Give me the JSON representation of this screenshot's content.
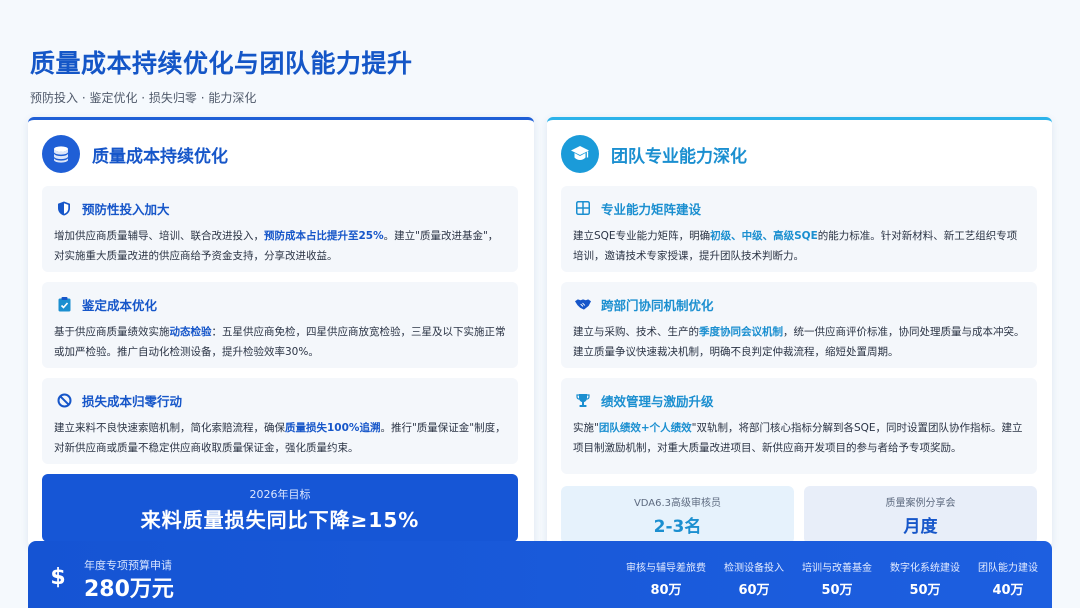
{
  "header": {
    "title": "质量成本持续优化与团队能力提升",
    "subtitle": "预防投入 · 鉴定优化 · 损失归零 · 能力深化"
  },
  "left_card": {
    "icon": "coins-icon",
    "title": "质量成本持续优化",
    "sections": [
      {
        "icon": "shield-icon",
        "title": "预防性投入加大",
        "body_a": "增加供应商质量辅导、培训、联合改进投入，",
        "body_hl": "预防成本占比提升至25%",
        "body_b": "。建立\"质量改进基金\"，对实施重大质量改进的供应商给予资金支持，分享改进收益。"
      },
      {
        "icon": "clipboard-check-icon",
        "title": "鉴定成本优化",
        "body_a": "基于供应商质量绩效实施",
        "body_hl": "动态检验",
        "body_b": "：五星供应商免检，四星供应商放宽检验，三星及以下实施正常或加严检验。推广自动化检测设备，提升检验效率30%。"
      },
      {
        "icon": "ban-icon",
        "title": "损失成本归零行动",
        "body_a": "建立来料不良快速索赔机制，简化索赔流程，确保",
        "body_hl": "质量损失100%追溯",
        "body_b": "。推行\"质量保证金\"制度，对新供应商或质量不稳定供应商收取质量保证金，强化质量约束。"
      }
    ],
    "goal": {
      "label": "2026年目标",
      "value": "来料质量损失同比下降≥15%"
    }
  },
  "right_card": {
    "icon": "graduation-cap-icon",
    "title": "团队专业能力深化",
    "sections": [
      {
        "icon": "grid-icon",
        "title": "专业能力矩阵建设",
        "body_a": "建立SQE专业能力矩阵，明确",
        "body_hl": "初级、中级、高级SQE",
        "body_b": "的能力标准。针对新材料、新工艺组织专项培训，邀请技术专家授课，提升团队技术判断力。"
      },
      {
        "icon": "handshake-icon",
        "title": "跨部门协同机制优化",
        "body_a": "建立与采购、技术、生产的",
        "body_hl": "季度协同会议机制",
        "body_b": "，统一供应商评价标准，协同处理质量与成本冲突。建立质量争议快速裁决机制，明确不良判定仲裁流程，缩短处置周期。"
      },
      {
        "icon": "trophy-icon",
        "title": "绩效管理与激励升级",
        "body_a": "实施\"",
        "body_hl": "团队绩效+个人绩效",
        "body_b": "\"双轨制，将部门核心指标分解到各SQE，同时设置团队协作指标。建立项目制激励机制，对重大质量改进项目、新供应商开发项目的参与者给予专项奖励。"
      }
    ],
    "stats": [
      {
        "label": "VDA6.3高级审核员",
        "value": "2-3名"
      },
      {
        "label": "质量案例分享会",
        "value": "月度"
      }
    ]
  },
  "budget": {
    "icon": "dollar-icon",
    "label": "年度专项预算申请",
    "value": "280万元",
    "items": [
      {
        "label": "审核与辅导差旅费",
        "value": "80万"
      },
      {
        "label": "检测设备投入",
        "value": "60万"
      },
      {
        "label": "培训与改善基金",
        "value": "50万"
      },
      {
        "label": "数字化系统建设",
        "value": "50万"
      },
      {
        "label": "团队能力建设",
        "value": "40万"
      }
    ]
  },
  "colors": {
    "primary": "#1656c9",
    "accent": "#1b8fd0",
    "background": "#f5f9fd"
  }
}
